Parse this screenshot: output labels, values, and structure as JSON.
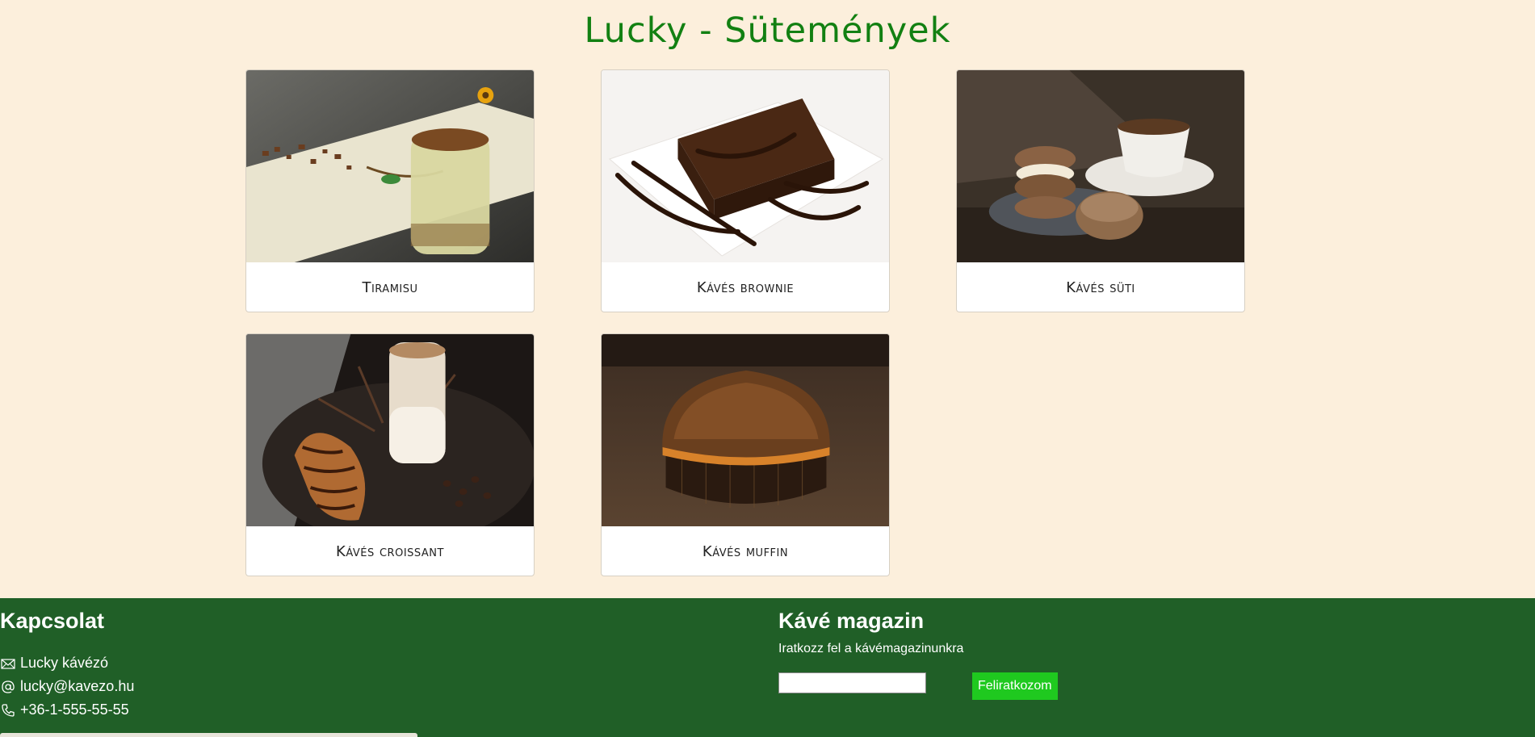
{
  "page": {
    "title": "Lucky - Sütemények"
  },
  "products": [
    {
      "name": "Tiramisu"
    },
    {
      "name": "Kávés brownie"
    },
    {
      "name": "Kávés süti"
    },
    {
      "name": "Kávés croissant"
    },
    {
      "name": "Kávés muffin"
    }
  ],
  "footer": {
    "contact": {
      "heading": "Kapcsolat",
      "lines": [
        {
          "icon": "envelope-icon",
          "text": "Lucky kávézó"
        },
        {
          "icon": "at-icon",
          "text": "lucky@kavezo.hu"
        },
        {
          "icon": "phone-icon",
          "text": "+36-1-555-55-55"
        }
      ]
    },
    "magazin": {
      "heading": "Kávé magazin",
      "subtitle": "Iratkozz fel a kávémagazinunkra",
      "input_placeholder": "",
      "button_label": "Feliratkozom"
    }
  },
  "colors": {
    "background": "#fcefdc",
    "title": "#128012",
    "footer": "#205f27",
    "button": "#1fc91f"
  }
}
